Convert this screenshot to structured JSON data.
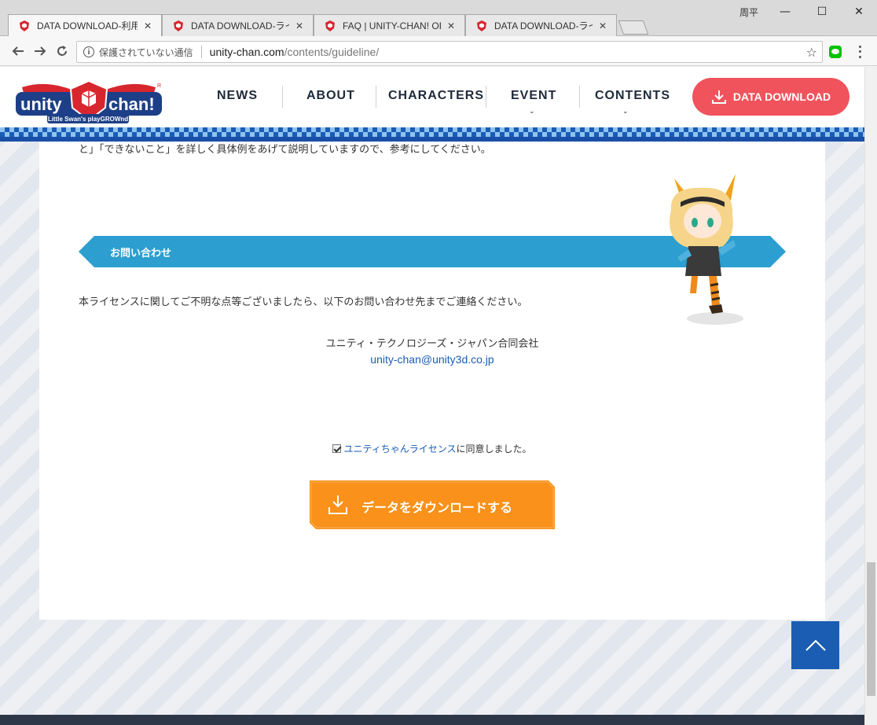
{
  "browser": {
    "tabs": [
      {
        "title": "DATA DOWNLOAD-利用規約",
        "active": true
      },
      {
        "title": "DATA DOWNLOAD-ライセンス",
        "active": false
      },
      {
        "title": "FAQ | UNITY-CHAN! OFFICIAL",
        "active": false
      },
      {
        "title": "DATA DOWNLOAD-ライセンス",
        "active": false
      }
    ],
    "user": "周平",
    "window_controls": {
      "minimize": "—",
      "maximize": "☐",
      "close": "✕"
    },
    "security_label": "保護されていない通信",
    "url_host": "unity-chan.com",
    "url_path": "/contents/guideline/",
    "tab_close": "✕"
  },
  "site": {
    "logo_text": "unity chan!",
    "logo_tagline": "Little Swan's playGROWnd",
    "nav": [
      {
        "label": "NEWS",
        "has_dropdown": false
      },
      {
        "label": "ABOUT",
        "has_dropdown": false
      },
      {
        "label": "CHARACTERS",
        "has_dropdown": false
      },
      {
        "label": "EVENT",
        "has_dropdown": true
      },
      {
        "label": "CONTENTS",
        "has_dropdown": true
      }
    ],
    "cta": "DATA DOWNLOAD",
    "accent_color": "#f0535c",
    "brand_blue": "#1a5db3"
  },
  "content": {
    "intro_tail": "と」「できないこと」を詳しく具体例をあげて説明していますので、参考にしてください。",
    "section_title": "お問い合わせ",
    "inquiry_text": "本ライセンスに関してご不明な点等ございましたら、以下のお問い合わせ先までご連絡ください。",
    "company": "ユニティ・テクノロジーズ・ジャパン合同会社",
    "email": "unity-chan@unity3d.co.jp",
    "agree_link": "ユニティちゃんライセンス",
    "agree_suffix": "に同意しました。",
    "agree_checked": true,
    "download_button": "データをダウンロードする"
  }
}
